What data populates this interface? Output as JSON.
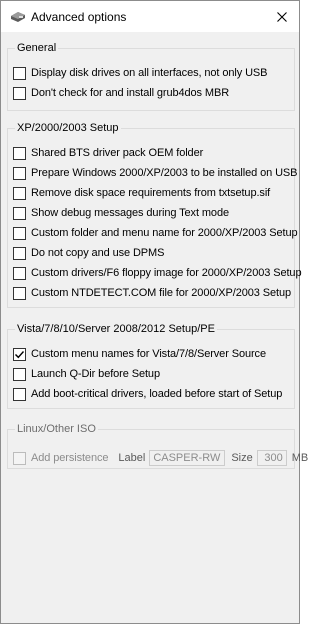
{
  "window": {
    "title": "Advanced options",
    "close_glyph": "close-icon"
  },
  "groups": {
    "general": {
      "title": "General",
      "options": [
        {
          "label": "Display disk drives on all interfaces, not only USB",
          "checked": false,
          "enabled": true
        },
        {
          "label": "Don't check for and install grub4dos MBR",
          "checked": false,
          "enabled": true
        }
      ]
    },
    "xp": {
      "title": "XP/2000/2003 Setup",
      "options": [
        {
          "label": "Shared BTS driver pack OEM folder",
          "checked": false,
          "enabled": true
        },
        {
          "label": "Prepare Windows 2000/XP/2003 to be installed on USB",
          "checked": false,
          "enabled": true
        },
        {
          "label": "Remove disk space requirements from txtsetup.sif",
          "checked": false,
          "enabled": true
        },
        {
          "label": "Show debug messages during Text mode",
          "checked": false,
          "enabled": true
        },
        {
          "label": "Custom folder and menu name for 2000/XP/2003 Setup",
          "checked": false,
          "enabled": true
        },
        {
          "label": "Do not copy and use DPMS",
          "checked": false,
          "enabled": true
        },
        {
          "label": "Custom drivers/F6 floppy image for 2000/XP/2003 Setup",
          "checked": false,
          "enabled": true
        },
        {
          "label": "Custom NTDETECT.COM file for 2000/XP/2003 Setup",
          "checked": false,
          "enabled": true
        }
      ]
    },
    "vista": {
      "title": "Vista/7/8/10/Server 2008/2012 Setup/PE",
      "options": [
        {
          "label": "Custom menu names for Vista/7/8/Server Source",
          "checked": true,
          "enabled": true
        },
        {
          "label": "Launch Q-Dir before Setup",
          "checked": false,
          "enabled": true
        },
        {
          "label": "Add boot-critical drivers, loaded before start of Setup",
          "checked": false,
          "enabled": true
        }
      ]
    },
    "linux": {
      "title": "Linux/Other ISO",
      "persistence": {
        "label": "Add persistence",
        "checked": false,
        "enabled": false,
        "volume_label_caption": "Label",
        "volume_label_value": "CASPER-RW",
        "size_caption": "Size",
        "size_value": "300",
        "size_unit": "MB"
      }
    }
  },
  "colors": {
    "checkmark": "#000000",
    "disabled_text": "#8c8c8c",
    "group_border": "#dcdcdc",
    "dialog_background": "#f0f0f0"
  }
}
